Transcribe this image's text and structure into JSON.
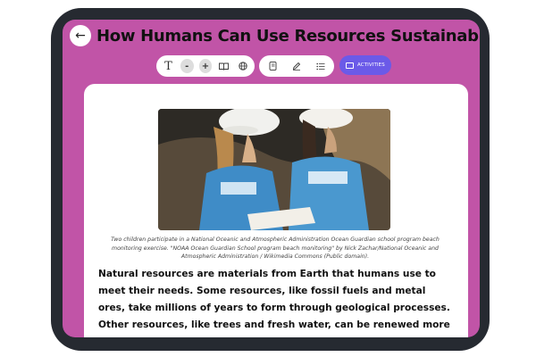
{
  "title": "How Humans Can Use Resources Sustainably",
  "toolbar": {
    "activities_label": "ACTIVITIES",
    "text_size_icon": "text-size-icon",
    "decrease_icon": "minus-icon",
    "increase_icon": "plus-icon",
    "read_icon": "book-icon",
    "language_icon": "globe-icon",
    "notes_icon": "notebook-icon",
    "annotate_icon": "pencil-icon",
    "list_icon": "list-icon",
    "decrease_glyph": "-",
    "increase_glyph": "+"
  },
  "colors": {
    "screen_bg": "#c154a7",
    "activities_bg": "#6b5ae8",
    "device_bezel": "#262a31"
  },
  "article": {
    "caption": "Two children participate in a National Oceanic and Atmospheric Administration Ocean Guardian school program beach monitoring exercise. \"NOAA Ocean Guardian School program beach monitoring\" by Nick Zachar/National Oceanic and Atmospheric Administration / Wikimedia Commons (Public domain).",
    "paragraph": "Natural resources are materials from Earth that humans use to meet their needs. Some resources, like fossil fuels and metal ores, take millions of years to form through geological processes. Other resources, like trees and fresh water, can be renewed more quickly. Understanding how slowly many resources form helps"
  }
}
